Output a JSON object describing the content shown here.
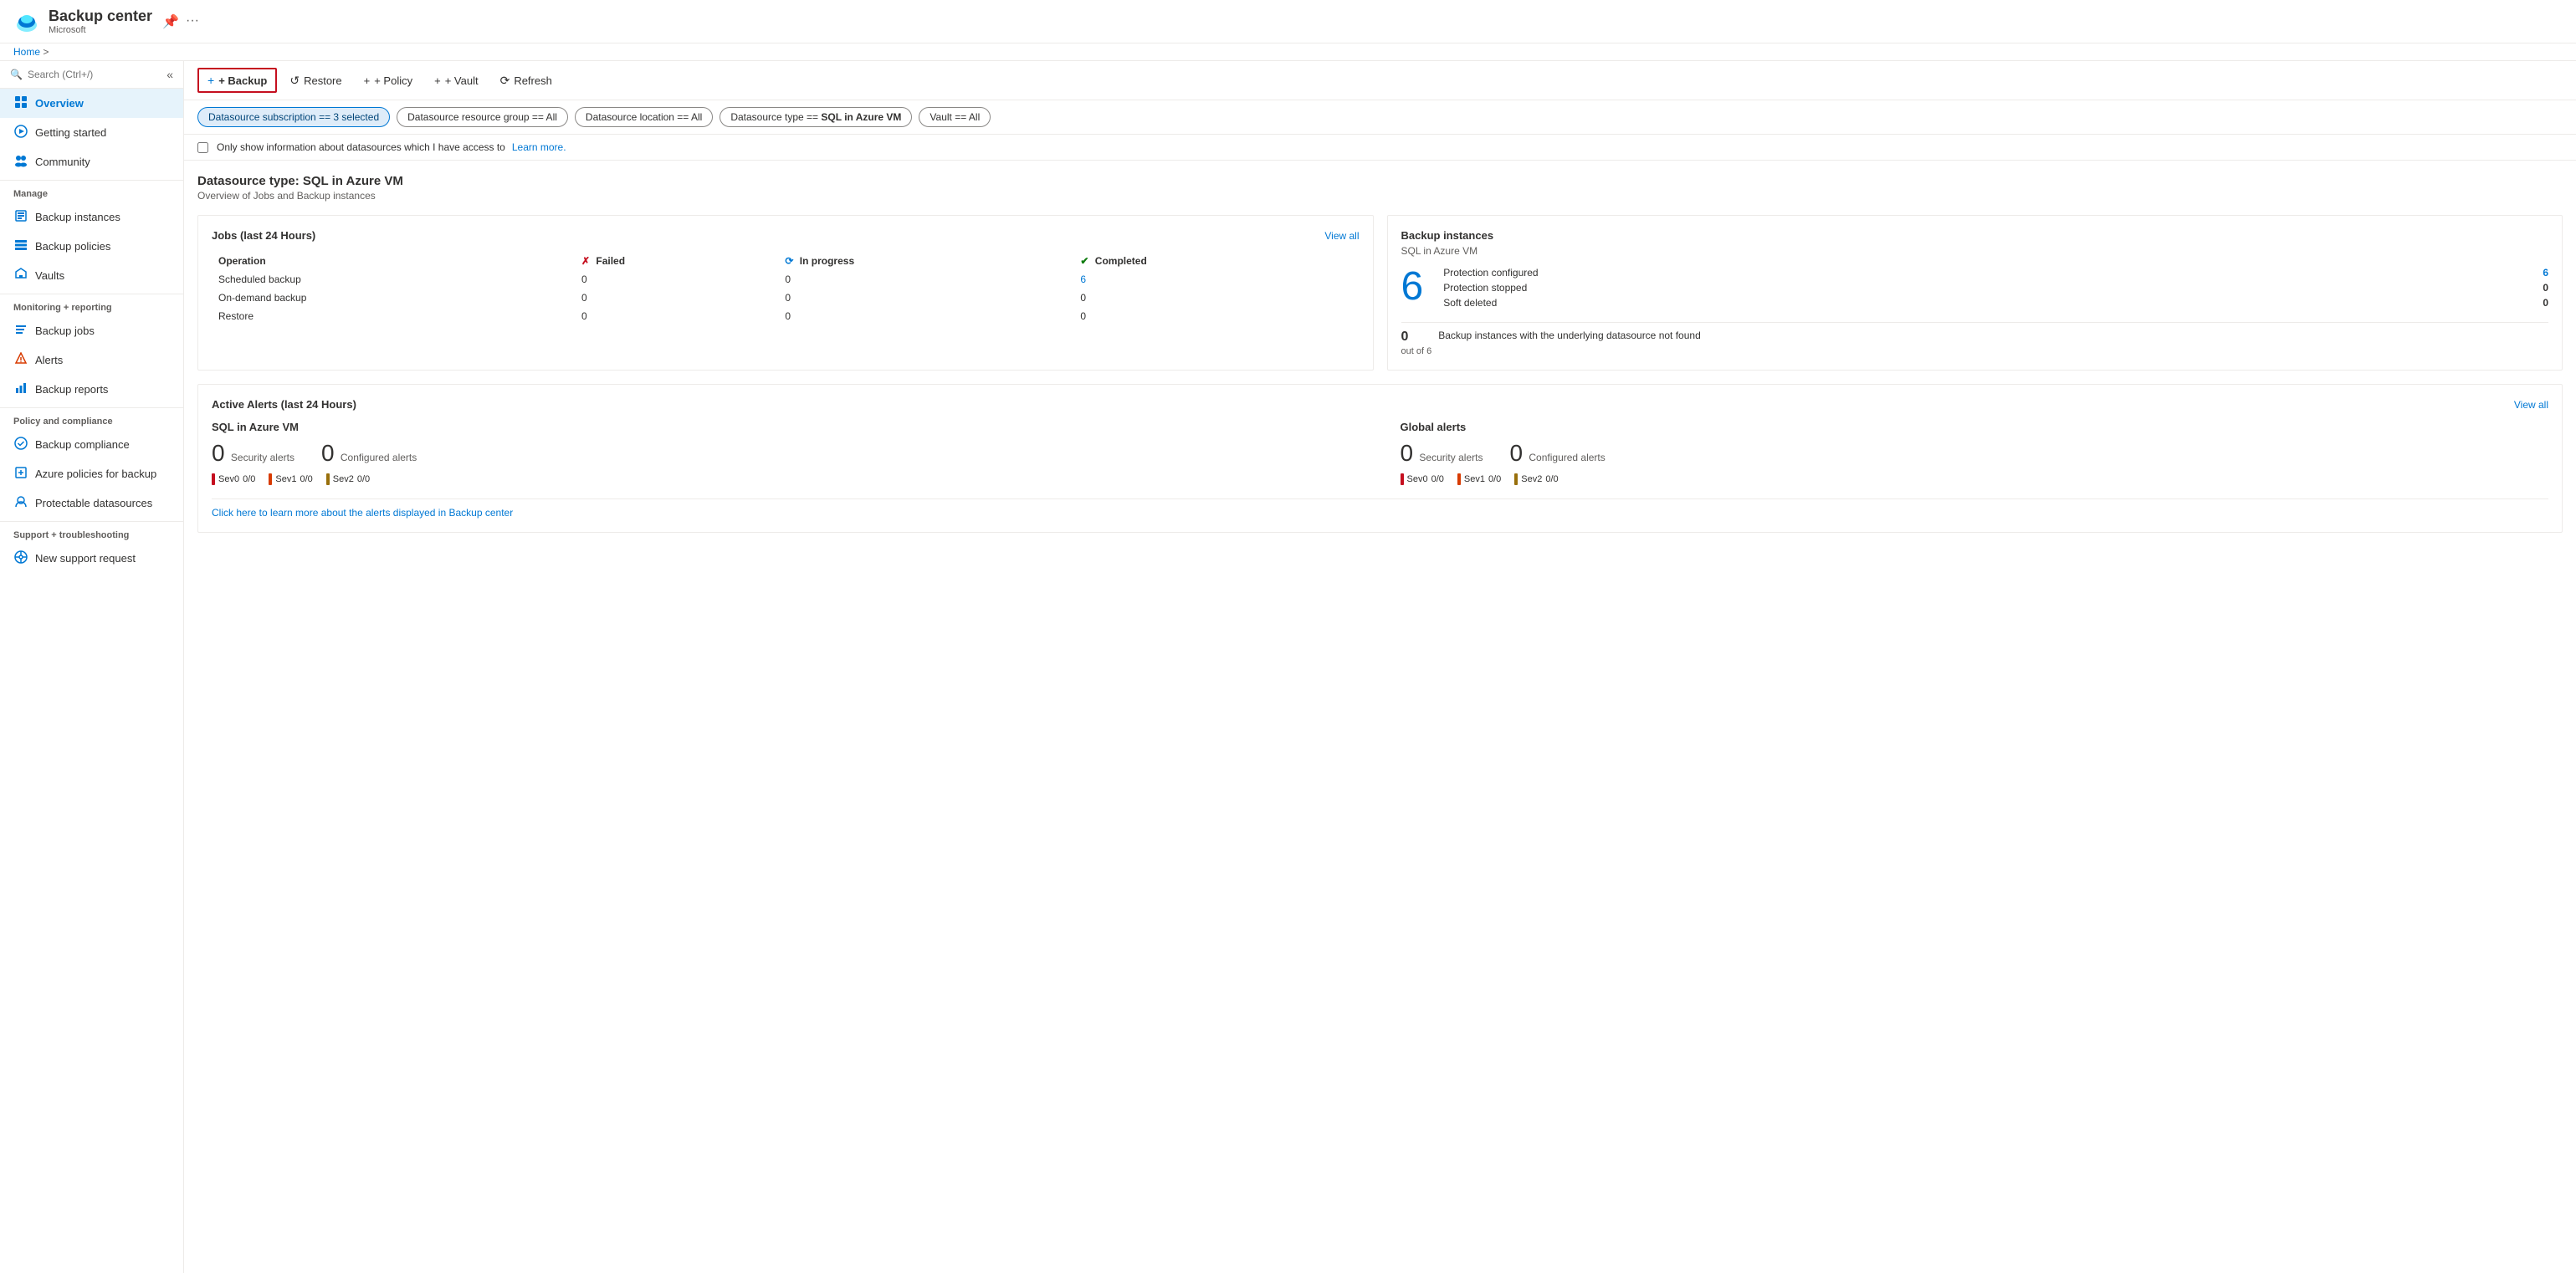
{
  "app": {
    "title": "Backup center",
    "subtitle": "Microsoft",
    "breadcrumb_home": "Home"
  },
  "toolbar": {
    "backup_label": "+ Backup",
    "restore_label": "Restore",
    "policy_label": "+ Policy",
    "vault_label": "+ Vault",
    "refresh_label": "Refresh"
  },
  "filters": [
    {
      "label": "Datasource subscription == 3 selected",
      "active": true
    },
    {
      "label": "Datasource resource group == All",
      "active": false
    },
    {
      "label": "Datasource location == All",
      "active": false
    },
    {
      "label": "Datasource type == SQL in Azure VM",
      "active": false
    },
    {
      "label": "Vault == All",
      "active": false
    }
  ],
  "info_bar": {
    "checkbox_label": "Only show information about datasources which I have access to",
    "learn_more": "Learn more."
  },
  "datasource": {
    "section_title": "Datasource type: SQL in Azure VM",
    "section_subtitle": "Overview of Jobs and Backup instances"
  },
  "jobs_card": {
    "title": "Jobs (last 24 Hours)",
    "view_all": "View all",
    "columns": {
      "operation": "Operation",
      "failed": "Failed",
      "in_progress": "In progress",
      "completed": "Completed"
    },
    "rows": [
      {
        "operation": "Scheduled backup",
        "failed": "0",
        "in_progress": "0",
        "completed": "6"
      },
      {
        "operation": "On-demand backup",
        "failed": "0",
        "in_progress": "0",
        "completed": "0"
      },
      {
        "operation": "Restore",
        "failed": "0",
        "in_progress": "0",
        "completed": "0"
      }
    ]
  },
  "backup_instances_card": {
    "title": "Backup instances",
    "subtitle": "SQL in Azure VM",
    "big_number": "6",
    "protection_configured_label": "Protection configured",
    "protection_configured_value": "6",
    "protection_stopped_label": "Protection stopped",
    "protection_stopped_value": "0",
    "soft_deleted_label": "Soft deleted",
    "soft_deleted_value": "0",
    "footer_num": "0",
    "footer_label": "out of 6",
    "footer_desc": "Backup instances with the underlying datasource not found"
  },
  "alerts_card": {
    "title": "Active Alerts (last 24 Hours)",
    "view_all": "View all",
    "sql_section": {
      "title": "SQL in Azure VM",
      "security_count": "0",
      "security_label": "Security alerts",
      "configured_count": "0",
      "configured_label": "Configured alerts",
      "sev0_label": "Sev0",
      "sev0_value": "0/0",
      "sev1_label": "Sev1",
      "sev1_value": "0/0",
      "sev2_label": "Sev2",
      "sev2_value": "0/0"
    },
    "global_section": {
      "title": "Global alerts",
      "security_count": "0",
      "security_label": "Security alerts",
      "configured_count": "0",
      "configured_label": "Configured alerts",
      "sev0_label": "Sev0",
      "sev0_value": "0/0",
      "sev1_label": "Sev1",
      "sev1_value": "0/0",
      "sev2_label": "Sev2",
      "sev2_value": "0/0"
    },
    "footer_link": "Click here to learn more about the alerts displayed in Backup center"
  },
  "sidebar": {
    "search_placeholder": "Search (Ctrl+/)",
    "nav": [
      {
        "id": "overview",
        "label": "Overview",
        "icon": "grid",
        "active": true,
        "section": null
      },
      {
        "id": "getting-started",
        "label": "Getting started",
        "icon": "rocket",
        "active": false,
        "section": null
      },
      {
        "id": "community",
        "label": "Community",
        "icon": "people",
        "active": false,
        "section": null
      },
      {
        "id": "manage",
        "label": "Manage",
        "section_label": "Manage"
      },
      {
        "id": "backup-instances",
        "label": "Backup instances",
        "icon": "cube",
        "active": false,
        "section": "Manage"
      },
      {
        "id": "backup-policies",
        "label": "Backup policies",
        "icon": "table",
        "active": false,
        "section": "Manage"
      },
      {
        "id": "vaults",
        "label": "Vaults",
        "icon": "shield",
        "active": false,
        "section": "Manage"
      },
      {
        "id": "monitoring",
        "label": "Monitoring + reporting",
        "section_label": "Monitoring + reporting"
      },
      {
        "id": "backup-jobs",
        "label": "Backup jobs",
        "icon": "list",
        "active": false,
        "section": "Monitoring + reporting"
      },
      {
        "id": "alerts",
        "label": "Alerts",
        "icon": "bell",
        "active": false,
        "section": "Monitoring + reporting"
      },
      {
        "id": "backup-reports",
        "label": "Backup reports",
        "icon": "chart",
        "active": false,
        "section": "Monitoring + reporting"
      },
      {
        "id": "policy-compliance",
        "label": "Policy and compliance",
        "section_label": "Policy and compliance"
      },
      {
        "id": "backup-compliance",
        "label": "Backup compliance",
        "icon": "check",
        "active": false,
        "section": "Policy and compliance"
      },
      {
        "id": "azure-policies",
        "label": "Azure policies for backup",
        "icon": "policy",
        "active": false,
        "section": "Policy and compliance"
      },
      {
        "id": "protectable",
        "label": "Protectable datasources",
        "icon": "datasource",
        "active": false,
        "section": "Policy and compliance"
      },
      {
        "id": "support",
        "label": "Support + troubleshooting",
        "section_label": "Support + troubleshooting"
      },
      {
        "id": "new-support",
        "label": "New support request",
        "icon": "support",
        "active": false,
        "section": "Support + troubleshooting"
      }
    ]
  }
}
